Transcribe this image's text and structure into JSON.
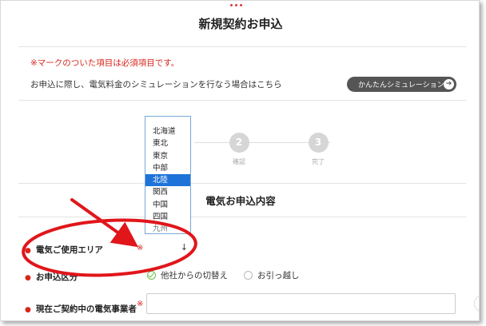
{
  "page": {
    "title": "新規契約お申込"
  },
  "notice": {
    "required": "※マークのついた項目は必須項目です。",
    "simulation_text": "お申込に際し、電気料金のシミュレーションを行なう場合はこちら",
    "simulation_button": "かんたんシミュレーション",
    "simulation_arrow_icon": "arrow-right-icon"
  },
  "steps": [
    {
      "number": "2",
      "label": "確認"
    },
    {
      "number": "3",
      "label": "完了"
    }
  ],
  "section": {
    "title": "電気お申込内容"
  },
  "form": {
    "area": {
      "label": "電気ご使用エリア",
      "required_mark": "※",
      "options": [
        "北海道",
        "東北",
        "東京",
        "中部",
        "北陸",
        "関西",
        "中国",
        "四国",
        "九州"
      ],
      "highlighted": "北陸",
      "arrow_icon": "chevron-down-icon",
      "arrow_glyph": "↓"
    },
    "application_type": {
      "label": "お申込区分",
      "options": [
        "他社からの切替え",
        "お引っ越し"
      ],
      "selected": "他社からの切替え"
    },
    "current_provider": {
      "label": "現在ご契約中の電気事業者",
      "required_mark": "※",
      "value": ""
    }
  },
  "colors": {
    "accent_red": "#d9261c",
    "annotation_red": "#e0161b",
    "button_dark": "#555555",
    "selection_blue": "#1e73d9",
    "check_green": "#6cc04a"
  }
}
